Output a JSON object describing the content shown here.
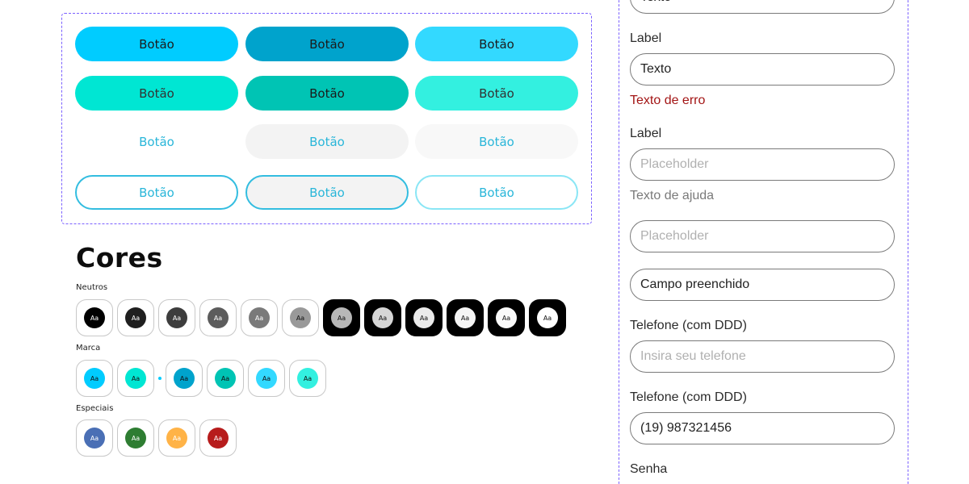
{
  "buttons": {
    "label": "Botão"
  },
  "colors": {
    "title": "Cores",
    "neutros": {
      "label": "Neutros",
      "sample": "Aa",
      "swatches": [
        "#000000",
        "#1f1f1f",
        "#3d3d3d",
        "#5c5c5c",
        "#7a7a7a",
        "#999999",
        "#b8b8b8",
        "#d6d6d6",
        "#ebebeb",
        "#f5f5f5",
        "#fafafa",
        "#ffffff"
      ]
    },
    "marca": {
      "label": "Marca",
      "sample": "Aa",
      "swatches": [
        "#00ccff",
        "#00e6d3",
        "#00a3cc",
        "#00c4b4",
        "#33d9ff",
        "#33f0e0"
      ]
    },
    "especiais": {
      "label": "Especiais",
      "sample": "Aa",
      "swatches": [
        "#4a6fb5",
        "#2e7d32",
        "#ffb347",
        "#b71c1c"
      ]
    }
  },
  "form": {
    "field0_value": "Texto",
    "field1_label": "Label",
    "field1_value": "Texto",
    "field1_error": "Texto de erro",
    "field2_label": "Label",
    "field2_placeholder": "Placeholder",
    "field2_help": "Texto de ajuda",
    "field3_placeholder": "Placeholder",
    "field4_value": "Campo preenchido",
    "field5_label": "Telefone (com DDD)",
    "field5_placeholder": "Insira seu telefone",
    "field6_label": "Telefone (com DDD)",
    "field6_value": "(19) 987321456",
    "field7_label": "Senha"
  }
}
